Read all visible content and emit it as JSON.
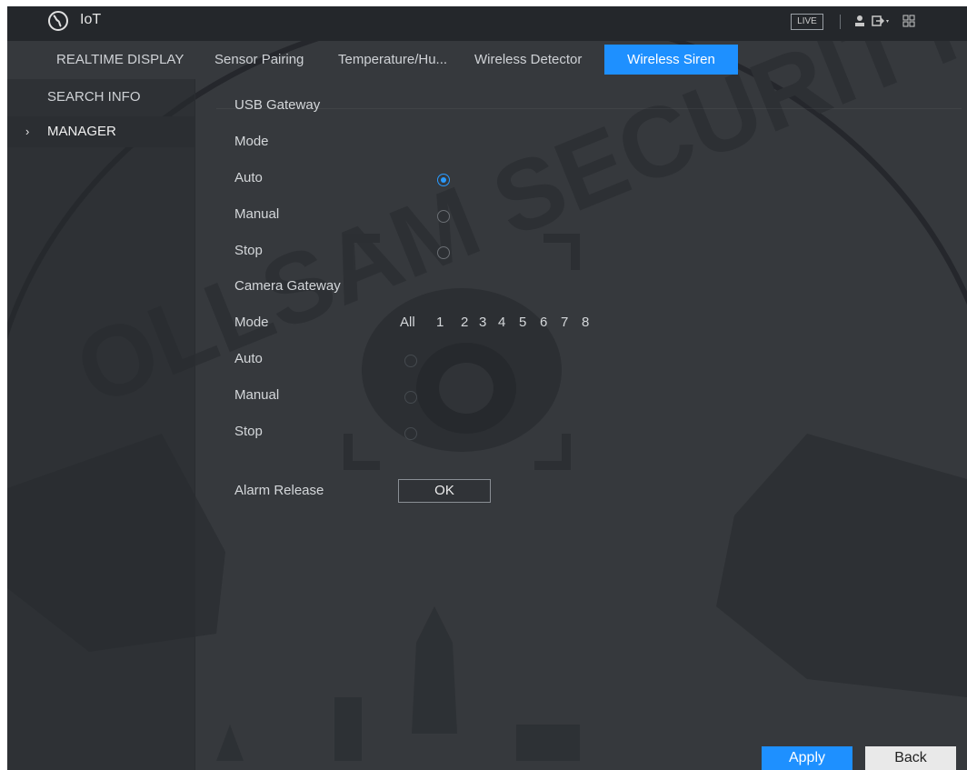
{
  "app": {
    "title": "IoT",
    "live_label": "LIVE"
  },
  "icons": {
    "globe": "globe-icon",
    "user": "user-icon",
    "logout": "logout-icon",
    "grid": "grid-icon"
  },
  "tabs": [
    {
      "label": "REALTIME DISPLAY"
    },
    {
      "label": "Sensor Pairing"
    },
    {
      "label": "Temperature/Hu..."
    },
    {
      "label": "Wireless Detector"
    },
    {
      "label": "Wireless Siren",
      "active": true
    }
  ],
  "sidebar": {
    "items": [
      {
        "label": "SEARCH INFO"
      },
      {
        "label": "MANAGER",
        "active": true
      }
    ]
  },
  "usb_gateway": {
    "title": "USB Gateway",
    "mode_label": "Mode",
    "options": [
      {
        "label": "Auto",
        "selected": true
      },
      {
        "label": "Manual",
        "selected": false
      },
      {
        "label": "Stop",
        "selected": false
      }
    ]
  },
  "camera_gateway": {
    "title": "Camera Gateway",
    "mode_label": "Mode",
    "channels": [
      "All",
      "1",
      "2",
      "3",
      "4",
      "5",
      "6",
      "7",
      "8"
    ],
    "options": [
      {
        "label": "Auto"
      },
      {
        "label": "Manual"
      },
      {
        "label": "Stop"
      }
    ]
  },
  "alarm_release": {
    "label": "Alarm Release",
    "button": "OK"
  },
  "footer": {
    "apply": "Apply",
    "back": "Back"
  },
  "colors": {
    "accent": "#1e90ff",
    "background": "#36393d",
    "titlebar": "#24272b"
  }
}
